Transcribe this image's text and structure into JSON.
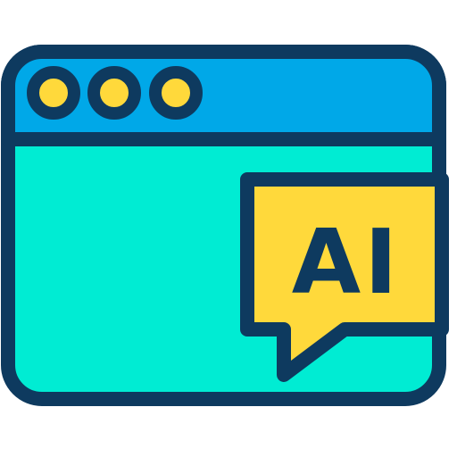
{
  "icon": {
    "name": "ai-browser-window-icon",
    "badge_text": "AI"
  },
  "colors": {
    "outline": "#0e3a5f",
    "title_bar": "#00a8e8",
    "window_body": "#00ecd3",
    "window_dots": "#ffd93b",
    "speech_bubble": "#ffd93b",
    "badge_text": "#0e3a5f"
  }
}
